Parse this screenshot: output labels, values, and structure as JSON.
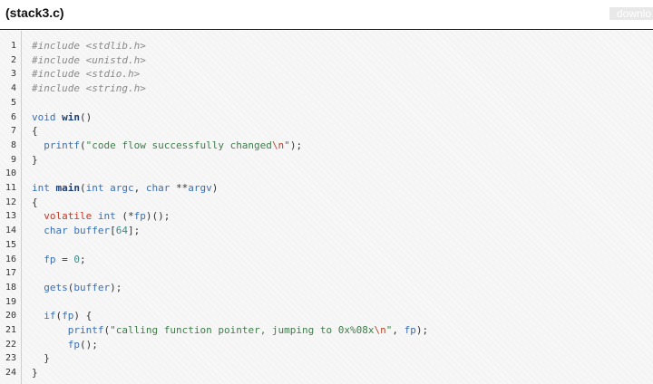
{
  "header": {
    "title": "(stack3.c)",
    "download_label": "downlo"
  },
  "code": {
    "line_numbers": [
      "1",
      "2",
      "3",
      "4",
      "5",
      "6",
      "7",
      "8",
      "9",
      "10",
      "11",
      "12",
      "13",
      "14",
      "15",
      "16",
      "17",
      "18",
      "19",
      "20",
      "21",
      "22",
      "23",
      "24"
    ],
    "lines": [
      "#include <stdlib.h>",
      "#include <unistd.h>",
      "#include <stdio.h>",
      "#include <string.h>",
      "",
      "void win()",
      "{",
      "  printf(\"code flow successfully changed\\n\");",
      "}",
      "",
      "int main(int argc, char **argv)",
      "{",
      "  volatile int (*fp)();",
      "  char buffer[64];",
      "",
      "  fp = 0;",
      "",
      "  gets(buffer);",
      "",
      "  if(fp) {",
      "      printf(\"calling function pointer, jumping to 0x%08x\\n\", fp);",
      "      fp();",
      "  }",
      "}"
    ]
  }
}
